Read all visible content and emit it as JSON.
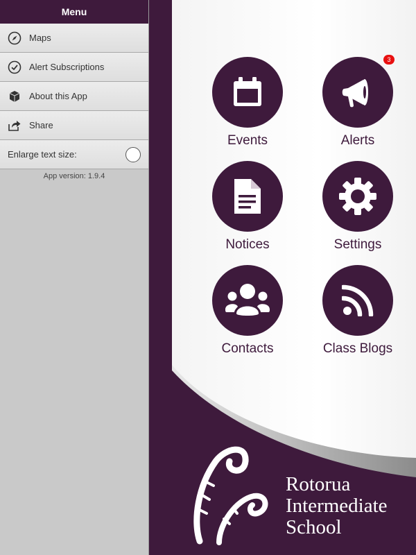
{
  "menu": {
    "title": "Menu",
    "items": [
      {
        "label": "Maps",
        "icon": "compass-icon"
      },
      {
        "label": "Alert Subscriptions",
        "icon": "check-circle-icon"
      },
      {
        "label": "About this App",
        "icon": "cube-icon"
      },
      {
        "label": "Share",
        "icon": "share-icon"
      }
    ],
    "enlarge_label": "Enlarge text size:",
    "version": "App version: 1.9.4"
  },
  "tiles": [
    {
      "label": "Events",
      "icon": "calendar-icon"
    },
    {
      "label": "Alerts",
      "icon": "megaphone-icon",
      "badge": "3"
    },
    {
      "label": "Notices",
      "icon": "document-icon"
    },
    {
      "label": "Settings",
      "icon": "gear-icon"
    },
    {
      "label": "Contacts",
      "icon": "people-icon"
    },
    {
      "label": "Class Blogs",
      "icon": "rss-icon"
    }
  ],
  "school": {
    "line1": "Rotorua",
    "line2": "Intermediate",
    "line3": "School"
  },
  "colors": {
    "brand": "#3e1a3c",
    "badge": "#e81010"
  }
}
